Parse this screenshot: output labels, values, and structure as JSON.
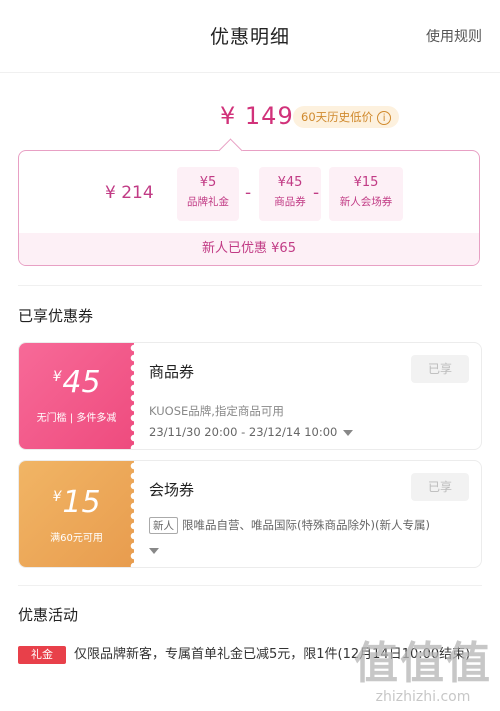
{
  "header": {
    "title": "优惠明细",
    "rules_link": "使用规则"
  },
  "price": {
    "final": "¥ 149",
    "low_badge": "60天历史低价",
    "info_icon": "info-icon"
  },
  "calc": {
    "original": "¥ 214",
    "operators": [
      "-",
      "-",
      "-"
    ],
    "chips": [
      {
        "value": "¥5",
        "name": "品牌礼金"
      },
      {
        "value": "¥45",
        "name": "商品券"
      },
      {
        "value": "¥15",
        "name": "新人会场券"
      }
    ],
    "footer": "新人已优惠 ¥65"
  },
  "coupons_section": {
    "title": "已享优惠券"
  },
  "coupons": [
    {
      "yen": "¥",
      "amount": "45",
      "condition": "无门槛 | 多件多减",
      "type": "商品券",
      "status": "已享",
      "description": "KUOSE品牌,指定商品可用",
      "date": "23/11/30 20:00 - 23/12/14 10:00",
      "color": "#f0588a"
    },
    {
      "yen": "¥",
      "amount": "15",
      "condition": "满60元可用",
      "type": "会场券",
      "status": "已享",
      "tag": "新人",
      "description": "限唯品自营、唯品国际(特殊商品除外)(新人专属)",
      "color": "#ecaa5a"
    }
  ],
  "promo_section": {
    "title": "优惠活动"
  },
  "promo": {
    "tag": "礼金",
    "text": "仅限品牌新客，专属首单礼金已减5元，限1件(12月14日10:00结束)"
  },
  "watermark": {
    "logo": "值值值",
    "url": "zhizhizhi.com"
  }
}
